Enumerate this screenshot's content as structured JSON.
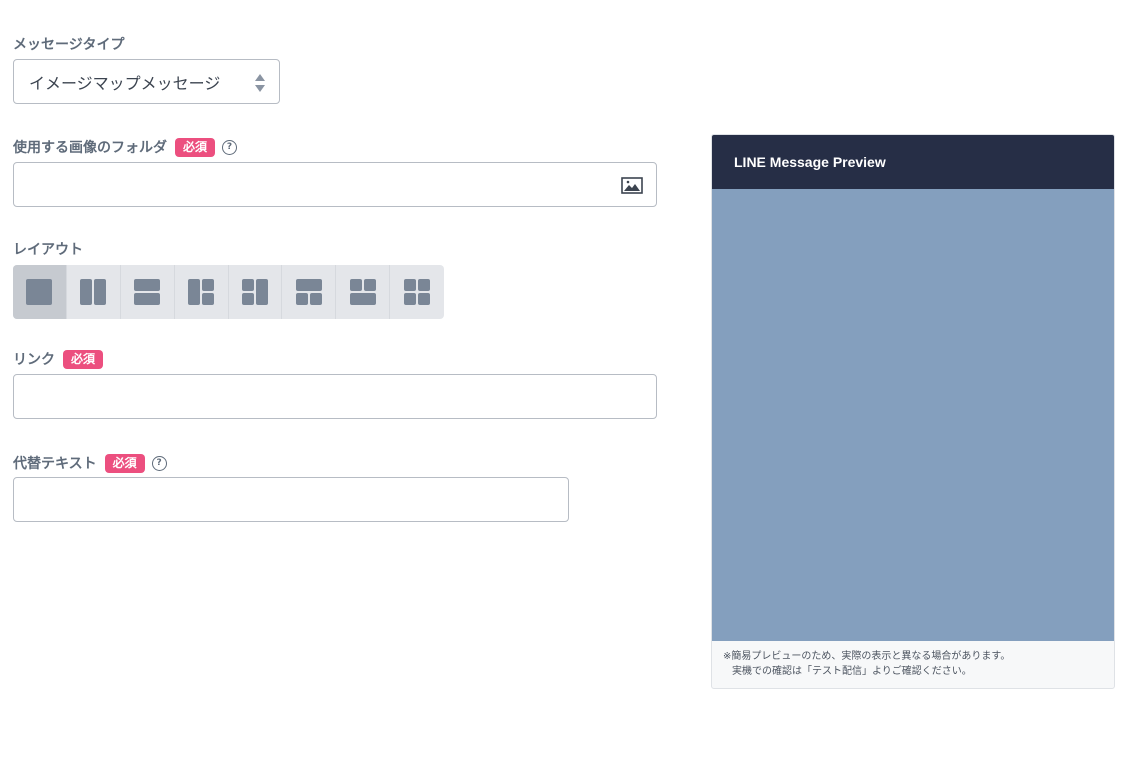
{
  "message_type": {
    "label": "メッセージタイプ",
    "selected": "イメージマップメッセージ"
  },
  "image_folder": {
    "label": "使用する画像のフォルダ",
    "required": "必須",
    "help": "?",
    "value": ""
  },
  "layout": {
    "label": "レイアウト",
    "options": [
      "single",
      "vertical-2",
      "horizontal-2",
      "right-split-3",
      "left-split-3",
      "top-split-3",
      "bottom-split-3",
      "grid-4"
    ],
    "selected_index": 0
  },
  "link": {
    "label": "リンク",
    "required": "必須",
    "value": ""
  },
  "alt_text": {
    "label": "代替テキスト",
    "required": "必須",
    "help": "?",
    "value": ""
  },
  "preview": {
    "title": "LINE Message Preview",
    "note_line1": "※簡易プレビューのため、実際の表示と異なる場合があります。",
    "note_line2": "実機での確認は「テスト配信」よりご確認ください。"
  },
  "colors": {
    "required_badge": "#ec4f7f",
    "preview_header": "#262e46",
    "preview_body": "#849fbe",
    "layout_icon": "#7a8696"
  }
}
